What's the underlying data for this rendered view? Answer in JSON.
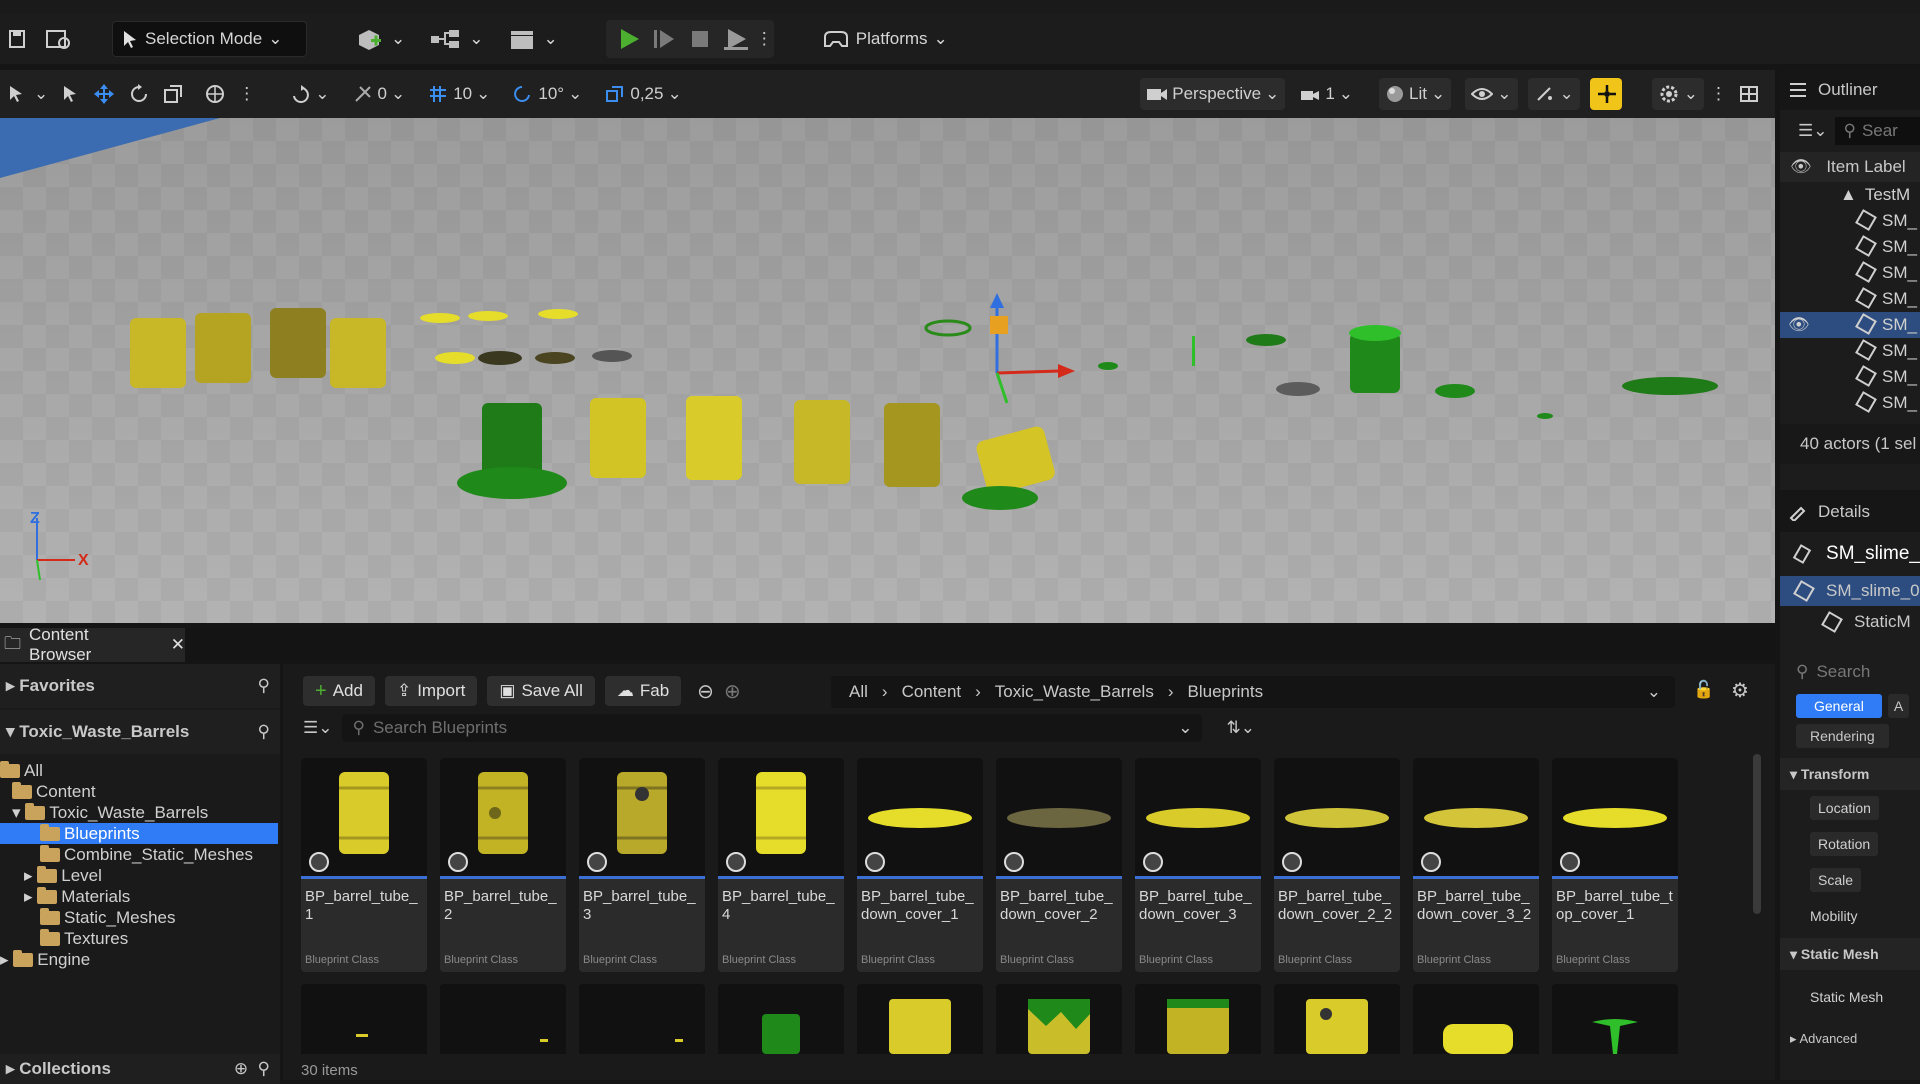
{
  "toolbar": {
    "selection_mode": "Selection Mode",
    "platforms": "Platforms"
  },
  "viewport_toolbar": {
    "rotate_snap_value": "0",
    "grid_snap_value": "10",
    "angle_snap_value": "10°",
    "scale_snap_value": "0,25",
    "perspective": "Perspective",
    "camera_speed": "1",
    "view_mode": "Lit"
  },
  "gizmo_axes": {
    "z": "Z",
    "x": "X"
  },
  "outliner": {
    "title": "Outliner",
    "search_placeholder": "Sear",
    "column": "Item Label",
    "root": "TestM",
    "items": [
      "SM_",
      "SM_",
      "SM_",
      "SM_",
      "SM_",
      "SM_",
      "SM_",
      "SM_"
    ],
    "status": "40 actors (1 sel"
  },
  "details": {
    "title": "Details",
    "actor_name": "SM_slime_",
    "component": "SM_slime_0",
    "sub_component": "StaticM",
    "search_placeholder": "Search",
    "tabs": [
      "General",
      "A",
      "Rendering"
    ],
    "sections": {
      "transform": "Transform",
      "static_mesh": "Static Mesh",
      "advanced": "Advanced"
    },
    "rows": [
      "Location",
      "Rotation",
      "Scale",
      "Mobility"
    ],
    "static_mesh_row": "Static Mesh"
  },
  "content_browser": {
    "tab": "Content Browser",
    "favorites": "Favorites",
    "root": "Toxic_Waste_Barrels",
    "tree": {
      "all": "All",
      "content": "Content",
      "toxic": "Toxic_Waste_Barrels",
      "blueprints": "Blueprints",
      "combine": "Combine_Static_Meshes",
      "level": "Level",
      "materials": "Materials",
      "static_meshes": "Static_Meshes",
      "textures": "Textures",
      "engine": "Engine"
    },
    "collections": "Collections",
    "buttons": {
      "add": "Add",
      "import": "Import",
      "save_all": "Save All",
      "fab": "Fab"
    },
    "breadcrumb": [
      "All",
      "Content",
      "Toxic_Waste_Barrels",
      "Blueprints"
    ],
    "search_placeholder": "Search Blueprints",
    "item_count": "30 items",
    "assets": [
      {
        "name": "BP_barrel_tube_1",
        "class": "Blueprint Class"
      },
      {
        "name": "BP_barrel_tube_2",
        "class": "Blueprint Class"
      },
      {
        "name": "BP_barrel_tube_3",
        "class": "Blueprint Class"
      },
      {
        "name": "BP_barrel_tube_4",
        "class": "Blueprint Class"
      },
      {
        "name": "BP_barrel_tube_down_cover_1",
        "class": "Blueprint Class"
      },
      {
        "name": "BP_barrel_tube_down_cover_2",
        "class": "Blueprint Class"
      },
      {
        "name": "BP_barrel_tube_down_cover_3",
        "class": "Blueprint Class"
      },
      {
        "name": "BP_barrel_tube_down_cover_2_2",
        "class": "Blueprint Class"
      },
      {
        "name": "BP_barrel_tube_down_cover_3_2",
        "class": "Blueprint Class"
      },
      {
        "name": "BP_barrel_tube_top_cover_1",
        "class": "Blueprint Class"
      }
    ]
  },
  "colors": {
    "accent": "#3b6fd4",
    "selection": "#2f7cf6",
    "barrel_yellow": "#d9cc2a",
    "slime_green": "#1f8a1a",
    "play_green": "#4caf2f",
    "snap_active": "#f0c419"
  }
}
